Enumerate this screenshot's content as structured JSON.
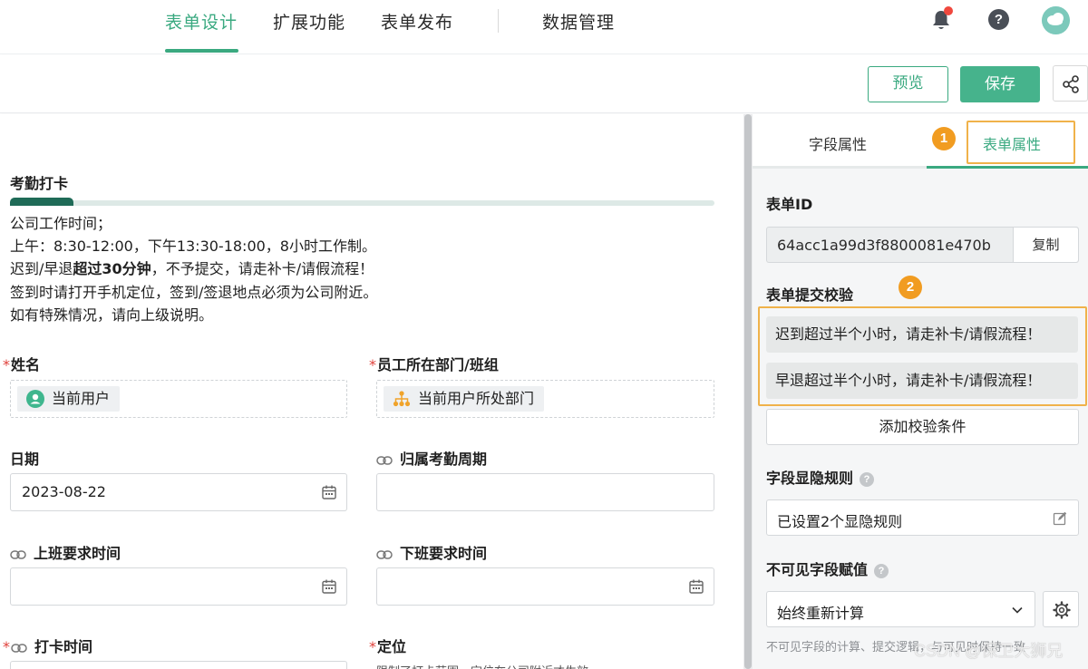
{
  "nav": {
    "tabs": [
      {
        "label": "表单设计",
        "active": true
      },
      {
        "label": "扩展功能",
        "active": false
      },
      {
        "label": "表单发布",
        "active": false
      },
      {
        "label": "数据管理",
        "active": false
      }
    ],
    "help_glyph": "?",
    "accent_color": "#3aa980"
  },
  "toolbar": {
    "preview_label": "预览",
    "save_label": "保存"
  },
  "form": {
    "section_title": "考勤打卡",
    "description_lines": [
      "公司工作时间；",
      "上午：8:30-12:00，下午13:30-18:00，8小时工作制。",
      {
        "pre": "迟到/早退",
        "bold": "超过30分钟",
        "post": "，不予提交，请走补卡/请假流程！"
      },
      "签到时请打开手机定位，签到/签退地点必须为公司附近。",
      "如有特殊情况，请向上级说明。"
    ],
    "fields": {
      "name": {
        "label": "姓名",
        "required_mark": "*",
        "chip": "当前用户"
      },
      "department": {
        "label": "员工所在部门/班组",
        "required_mark": "*",
        "chip": "当前用户所处部门"
      },
      "date": {
        "label": "日期",
        "value": "2023-08-22"
      },
      "period": {
        "label": "归属考勤周期"
      },
      "start_time": {
        "label": "上班要求时间"
      },
      "end_time": {
        "label": "下班要求时间"
      },
      "punch_time": {
        "label": "打卡时间",
        "required_mark": "*"
      },
      "location": {
        "label": "定位",
        "required_mark": "*",
        "note": "限制了打卡范围，定位在公司附近才生效"
      }
    }
  },
  "panel": {
    "tabs": {
      "field_props": "字段属性",
      "form_props": "表单属性"
    },
    "badges": {
      "one": "1",
      "two": "2"
    },
    "form_id": {
      "label": "表单ID",
      "value": "64acc1a99d3f8800081e470b",
      "copy_label": "复制"
    },
    "validation": {
      "label": "表单提交校验",
      "rules": [
        "迟到超过半个小时，请走补卡/请假流程！",
        "早退超过半个小时，请走补卡/请假流程！"
      ],
      "add_label": "添加校验条件"
    },
    "visibility": {
      "label": "字段显隐规则",
      "value": "已设置2个显隐规则"
    },
    "invisible": {
      "label": "不可见字段赋值",
      "selected": "始终重新计算",
      "help": "不可见字段的计算、提交逻辑，与可见时保持一致"
    },
    "highlight_color": "#f0b24a",
    "badge_color": "#f19c21"
  },
  "watermark": "CSDN @保卫大狮兄"
}
